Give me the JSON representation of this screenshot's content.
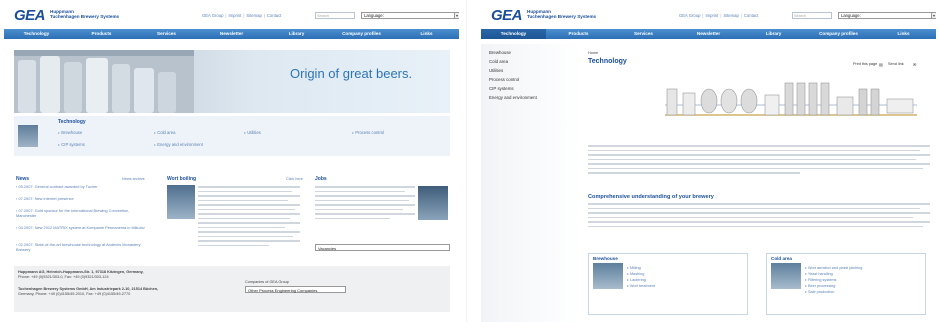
{
  "header": {
    "logo": "GEA",
    "brand_line1": "Huppmann",
    "brand_line2": "Tuchenhagen Brewery Systems",
    "top_links": [
      "GEA Group",
      "Imprint",
      "Sitemap",
      "Contact"
    ],
    "search_placeholder": "Search",
    "language_label": "Language:"
  },
  "nav": [
    "Technology",
    "Products",
    "Services",
    "Newsletter",
    "Library",
    "Company profiles",
    "Links"
  ],
  "left": {
    "hero_title": "Origin of great beers.",
    "technology_title": "Technology",
    "technology_links": [
      "Brewhouse",
      "Cold area",
      "Utilities",
      "Process control",
      "CIP systems",
      "Energy and environment"
    ],
    "news_title": "News",
    "news_more": "News archive",
    "news_items": [
      "05.2007: General contract awarded by Tucher",
      "07.2007: New internet presence",
      "07.2007: Gold sponsor for the International Brewing Convention, Manchester",
      "04.2007: New 2012 MATRIX system at Kompanie Permanenta in Mikulov",
      "02.2007: State-of-the-art brewhouse technology at Andechs Monastery Brewery"
    ],
    "wort_title": "Wort boiling",
    "wort_more": "Click here",
    "jobs_title": "Jobs",
    "jobs_select": "Vacancies",
    "companies_label": "Companies of GEA Group",
    "companies_select": "Other Process Engineering Companies",
    "footer_line1": "Huppmann AG, Heinrich-Huppmann-Str. 1, 97318 Kitzingen, Germany,",
    "footer_line2": "Phone: +49 (0)9321/303-0, Fax: +49 (0)9321/303-124",
    "footer_line3": "Tuchenhagen Brewery Systems GmbH, Am Industriepark 2-10, 21514 Büchen,",
    "footer_line4": "Germany, Phone: +49 (0)4155/49-2010, Fax: +49 (0)4155/49-2770"
  },
  "right": {
    "sidebar_items": [
      "Brewhouse",
      "Cold area",
      "Utilities",
      "Process control",
      "CIP systems",
      "Energy and environment"
    ],
    "breadcrumb": "Home",
    "page_title": "Technology",
    "print_label": "Print this page",
    "send_label": "Send link",
    "subheading": "Comprehensive understanding of your brewery",
    "brewhouse_box_title": "Brewhouse",
    "brewhouse_links": [
      "Milling",
      "Mashing",
      "Lautering",
      "Wort treatment"
    ],
    "cold_box_title": "Cold area",
    "cold_links": [
      "Wort aeration and yeast pitching",
      "Yeast handling",
      "Filtering systems",
      "Beer processing",
      "Sale production"
    ]
  },
  "colors": {
    "brand_blue": "#1b4f9a",
    "nav_blue": "#2d6fb5",
    "link_blue": "#5b82b5",
    "hero_text": "#2f74b7"
  }
}
